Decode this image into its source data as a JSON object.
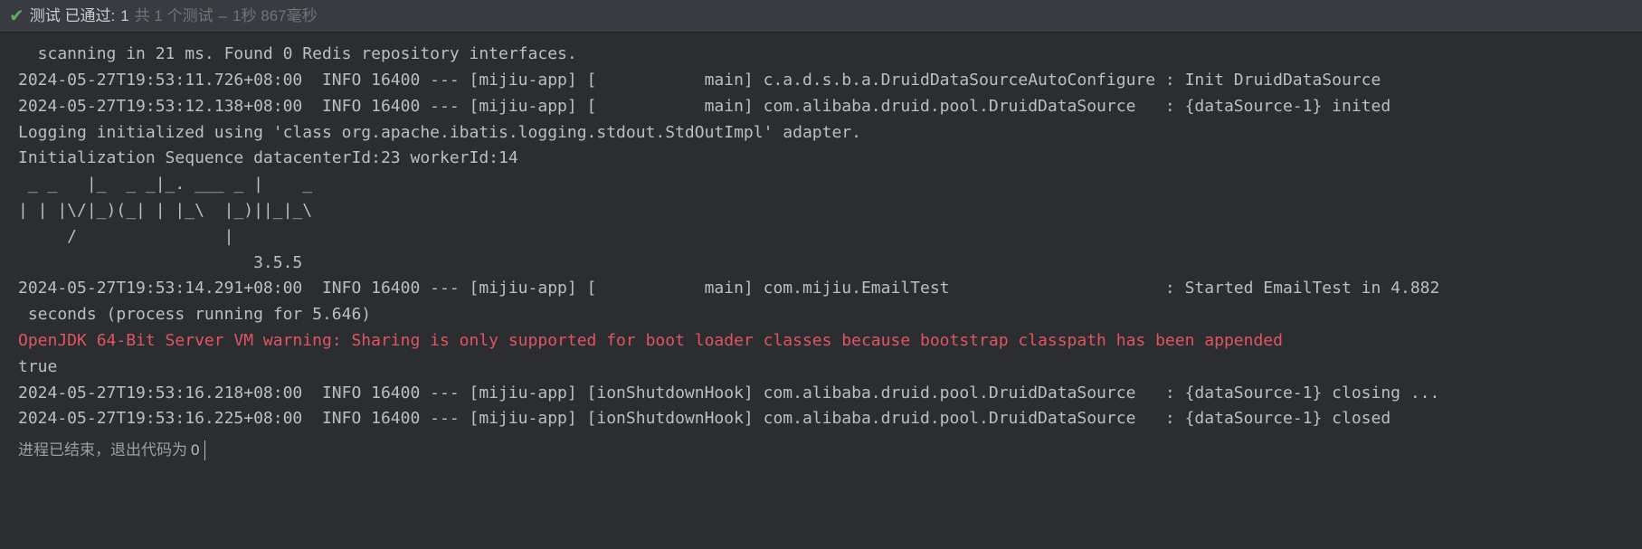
{
  "status": {
    "label_prefix": "测试 已通过:",
    "passed": "1",
    "total_tests_label": "共 1 个测试",
    "separator": "–",
    "duration": "1秒 867毫秒"
  },
  "log_lines": [
    {
      "text": "  scanning in 21 ms. Found 0 Redis repository interfaces.",
      "class": ""
    },
    {
      "text": "2024-05-27T19:53:11.726+08:00  INFO 16400 --- [mijiu-app] [           main] c.a.d.s.b.a.DruidDataSourceAutoConfigure : Init DruidDataSource",
      "class": ""
    },
    {
      "text": "2024-05-27T19:53:12.138+08:00  INFO 16400 --- [mijiu-app] [           main] com.alibaba.druid.pool.DruidDataSource   : {dataSource-1} inited",
      "class": ""
    },
    {
      "text": "Logging initialized using 'class org.apache.ibatis.logging.stdout.StdOutImpl' adapter.",
      "class": ""
    },
    {
      "text": "Initialization Sequence datacenterId:23 workerId:14",
      "class": ""
    },
    {
      "text": " _ _   |_  _ _|_. ___ _ |    _ ",
      "class": ""
    },
    {
      "text": "| | |\\/|_)(_| | |_\\  |_)||_|_\\ ",
      "class": ""
    },
    {
      "text": "     /               |         ",
      "class": ""
    },
    {
      "text": "                        3.5.5 ",
      "class": ""
    },
    {
      "text": "2024-05-27T19:53:14.291+08:00  INFO 16400 --- [mijiu-app] [           main] com.mijiu.EmailTest                      : Started EmailTest in 4.882",
      "class": ""
    },
    {
      "text": " seconds (process running for 5.646)",
      "class": ""
    },
    {
      "text": "OpenJDK 64-Bit Server VM warning: Sharing is only supported for boot loader classes because bootstrap classpath has been appended",
      "class": "warn"
    },
    {
      "text": "true",
      "class": ""
    },
    {
      "text": "2024-05-27T19:53:16.218+08:00  INFO 16400 --- [mijiu-app] [ionShutdownHook] com.alibaba.druid.pool.DruidDataSource   : {dataSource-1} closing ...",
      "class": ""
    },
    {
      "text": "2024-05-27T19:53:16.225+08:00  INFO 16400 --- [mijiu-app] [ionShutdownHook] com.alibaba.druid.pool.DruidDataSource   : {dataSource-1} closed",
      "class": ""
    }
  ],
  "footer": {
    "exit_label": "进程已结束，退出代码为",
    "exit_code": "0"
  }
}
